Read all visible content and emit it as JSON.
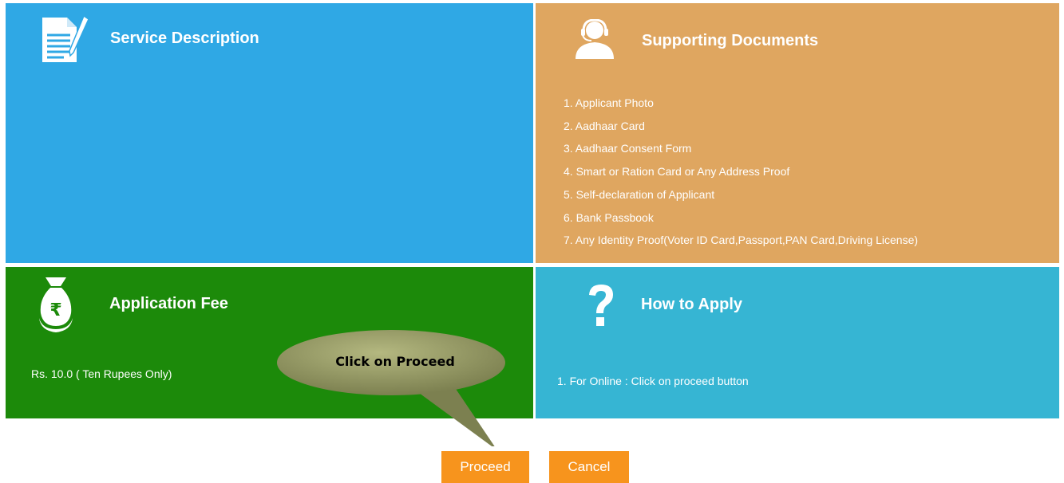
{
  "service_description": {
    "title": "Service Description",
    "icon": "document-pen-icon"
  },
  "supporting_documents": {
    "title": "Supporting Documents",
    "icon": "user-icon",
    "items": [
      "1. Applicant Photo",
      "2. Aadhaar Card",
      "3. Aadhaar Consent Form",
      "4. Smart or Ration Card or Any Address Proof",
      "5. Self-declaration of Applicant",
      "6. Bank Passbook",
      "7. Any Identity Proof(Voter ID Card,Passport,PAN Card,Driving License)"
    ]
  },
  "application_fee": {
    "title": "Application Fee",
    "icon": "rupee-money-bag-icon",
    "fee": "Rs. 10.0 ( Ten Rupees Only)"
  },
  "how_to_apply": {
    "title": "How to Apply",
    "icon": "question-mark-icon",
    "steps": [
      "1. For Online : Click on proceed button"
    ]
  },
  "callout": {
    "text": "Click on Proceed"
  },
  "buttons": {
    "proceed": "Proceed",
    "cancel": "Cancel"
  },
  "colors": {
    "service_description": "#2fa8e5",
    "supporting_documents": "#dfa660",
    "application_fee": "#1c8a0a",
    "how_to_apply": "#36b5d3",
    "button": "#f7941d"
  }
}
